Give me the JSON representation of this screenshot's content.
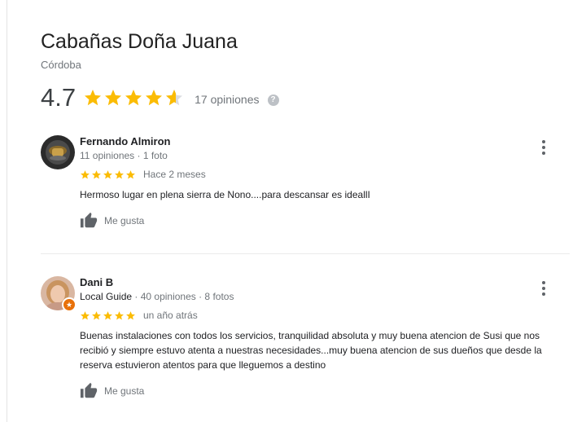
{
  "place": {
    "name": "Cabañas Doña Juana",
    "location": "Córdoba",
    "rating": "4.7",
    "stars_filled": 4.7,
    "reviews_count": "17 opiniones",
    "help_icon": "?"
  },
  "colors": {
    "star": "#fbbc04",
    "star_empty": "#dadce0",
    "badge": "#e8710a"
  },
  "reviews": [
    {
      "author": "Fernando Almiron",
      "local_guide": "",
      "stats": "11 opiniones · 1 foto",
      "rating": 5,
      "date": "Hace 2 meses",
      "text": "Hermoso lugar en plena sierra de Nono....para descansar es ideallI",
      "like_label": "Me gusta"
    },
    {
      "author": "Dani B",
      "local_guide": "Local Guide",
      "stats": " · 40 opiniones · 8 fotos",
      "rating": 5,
      "date": "un año atrás",
      "text": "Buenas instalaciones con todos los servicios, tranquilidad absoluta y muy buena atencion de Susi que nos recibió  y siempre estuvo atenta a nuestras necesidades...muy buena atencion de sus dueños que desde la reserva estuvieron atentos para que lleguemos a destino",
      "like_label": "Me gusta"
    }
  ]
}
